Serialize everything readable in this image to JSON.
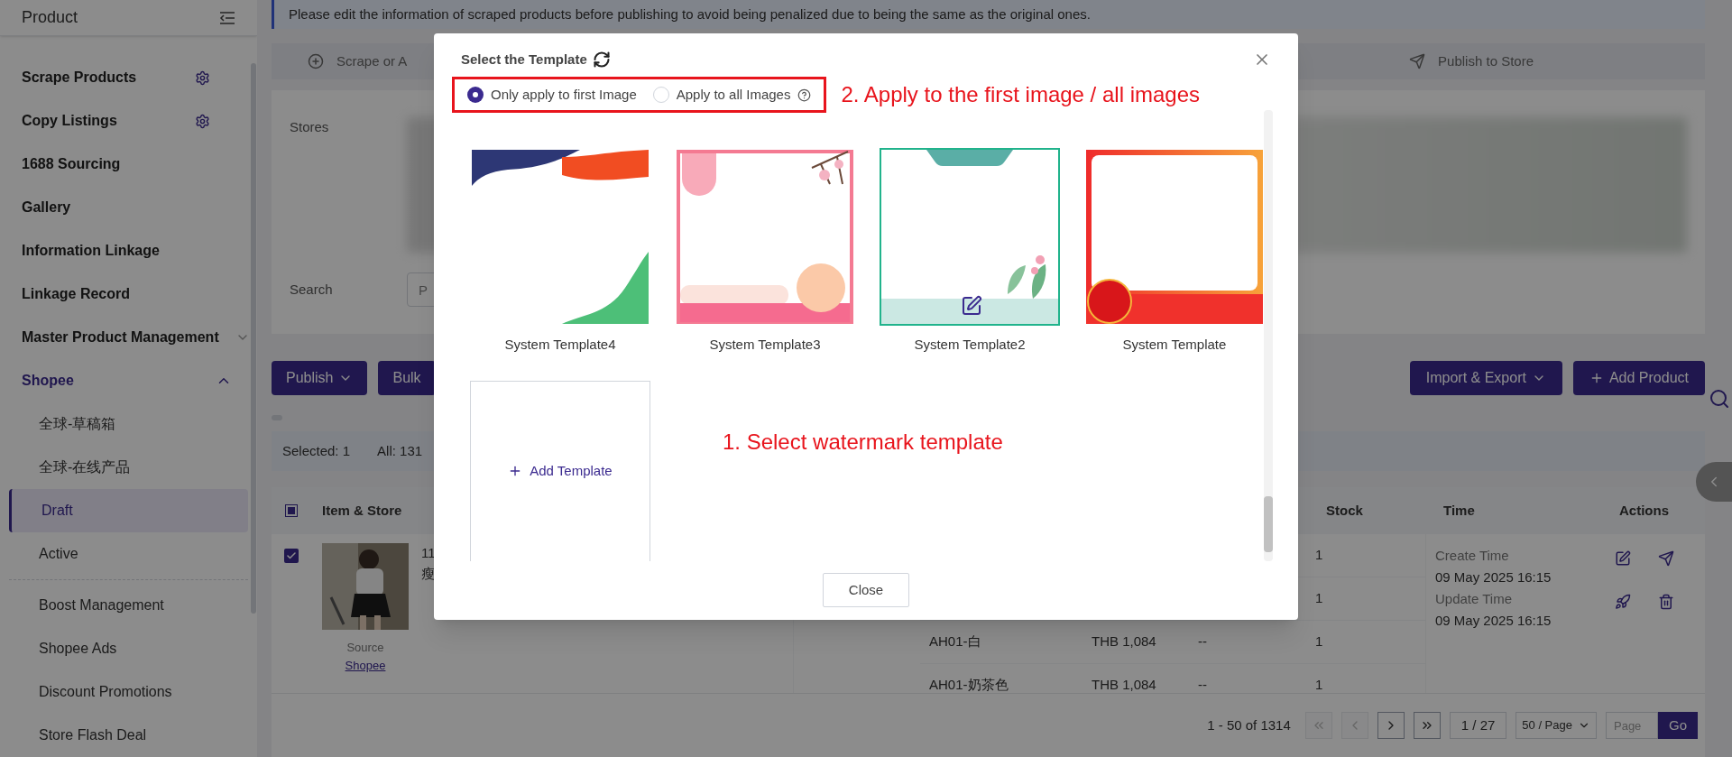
{
  "sidebar": {
    "title": "Product",
    "items": [
      {
        "label": "Scrape Products",
        "kind": "item",
        "settings": true
      },
      {
        "label": "Copy Listings",
        "kind": "item",
        "settings": true
      },
      {
        "label": "1688 Sourcing",
        "kind": "item",
        "settings": false
      },
      {
        "label": "Gallery",
        "kind": "item",
        "settings": false
      },
      {
        "label": "Information Linkage",
        "kind": "item",
        "settings": false
      },
      {
        "label": "Linkage Record",
        "kind": "item",
        "settings": false
      },
      {
        "label": "Master Product Management",
        "kind": "group",
        "expanded": false
      },
      {
        "label": "Shopee",
        "kind": "group",
        "expanded": true,
        "children": [
          {
            "label": "全球-草稿箱",
            "selected": false
          },
          {
            "label": "全球-在线产品",
            "selected": false
          },
          {
            "label": "Draft",
            "selected": true
          },
          {
            "label": "Active",
            "selected": false
          }
        ]
      }
    ],
    "more_items": [
      {
        "label": "Boost Management"
      },
      {
        "label": "Shopee Ads"
      },
      {
        "label": "Discount Promotions"
      },
      {
        "label": "Store Flash Deal"
      }
    ]
  },
  "notice": "Please edit the information of scraped products before publishing to avoid being penalized due to being the same as the original ones.",
  "steps": [
    {
      "label": "Scrape or A",
      "kind": "scrape"
    },
    {
      "label": "Publish to Store",
      "kind": "publish"
    }
  ],
  "stores": {
    "label": "Stores"
  },
  "search": {
    "label": "Search",
    "placeholder": "P"
  },
  "toolbar": {
    "left": [
      {
        "label": "Publish",
        "kind": "dropdown"
      },
      {
        "label": "Bulk",
        "kind": "plain"
      }
    ],
    "right": [
      {
        "label": "Import & Export",
        "kind": "dropdown"
      },
      {
        "label": "Add Product",
        "kind": "add"
      }
    ]
  },
  "selection_bar": {
    "selected": "Selected: 1",
    "all": "All: 131"
  },
  "table": {
    "columns": [
      "Item & Store",
      "Stock",
      "Time",
      "Actions"
    ],
    "indeterminate": true,
    "rows": [
      {
        "checked": true,
        "title": "11",
        "subtitle": "瘦",
        "source_label": "Source",
        "source": "Shopee",
        "variants": [
          {
            "stock": "1"
          },
          {
            "stock": "1"
          },
          {
            "name": "AH01-白",
            "price": "THB 1,084",
            "column_3": "--",
            "stock": "1"
          },
          {
            "name": "AH01-奶茶色",
            "price": "THB 1,084",
            "column_3": "--",
            "stock": "1"
          }
        ],
        "times": [
          {
            "label": "Create Time",
            "value": "09 May 2025 16:15"
          },
          {
            "label": "Update Time",
            "value": "09 May 2025 16:15"
          }
        ]
      }
    ]
  },
  "pagination": {
    "summary": "1 - 50 of 1314",
    "nav": [
      {
        "kind": "first",
        "disabled": true
      },
      {
        "kind": "prev",
        "disabled": true
      },
      {
        "kind": "next",
        "disabled": false
      },
      {
        "kind": "last",
        "disabled": false
      }
    ],
    "page": "1 / 27",
    "page_size": "50 / Page",
    "jump_placeholder": "Page",
    "go": "Go"
  },
  "modal": {
    "title": "Select the Template",
    "options": [
      {
        "label": "Only apply to first Image",
        "selected": true,
        "help": false
      },
      {
        "label": "Apply to all Images",
        "selected": false,
        "help": true
      }
    ],
    "templates": [
      {
        "name": "System Template4",
        "kind": "wave",
        "selected": false
      },
      {
        "name": "System Template3",
        "kind": "blossom",
        "selected": false
      },
      {
        "name": "System Template2",
        "kind": "leaf",
        "selected": true
      },
      {
        "name": "System Template",
        "kind": "sale",
        "selected": false
      }
    ],
    "add_template": "Add Template",
    "close": "Close"
  },
  "annotations": [
    "2. Apply to the first image / all images",
    "1. Select watermark template"
  ]
}
